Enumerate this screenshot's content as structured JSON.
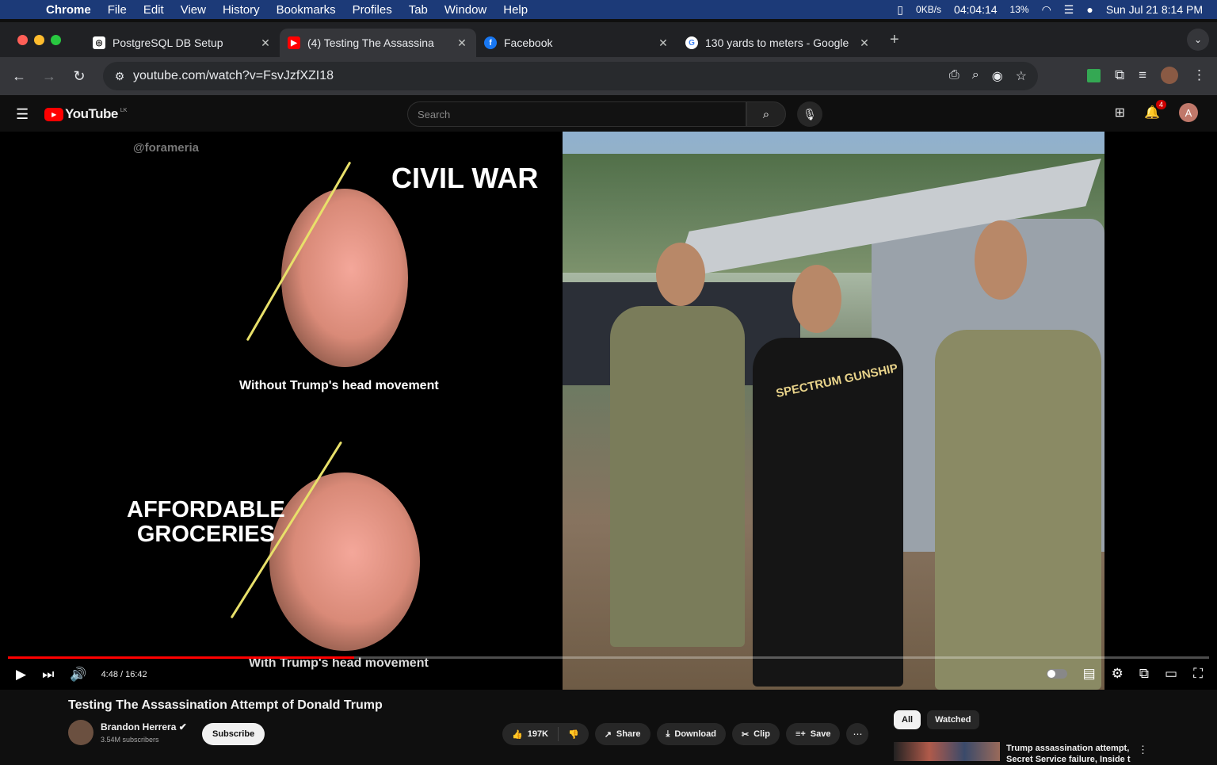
{
  "menubar": {
    "app": "Chrome",
    "items": [
      "File",
      "Edit",
      "View",
      "History",
      "Bookmarks",
      "Profiles",
      "Tab",
      "Window",
      "Help"
    ],
    "net": "0KB/s",
    "battery_time": "04:04:14",
    "battery_pct": "13%",
    "datetime": "Sun Jul 21  8:14 PM"
  },
  "tabs": [
    {
      "title": "PostgreSQL DB Setup",
      "icon": "openai-icon"
    },
    {
      "title": "(4) Testing The Assassina",
      "icon": "youtube-icon"
    },
    {
      "title": "Facebook",
      "icon": "facebook-icon"
    },
    {
      "title": "130 yards to meters - Google",
      "icon": "google-icon"
    }
  ],
  "address": {
    "url": "youtube.com/watch?v=FsvJzfXZI18"
  },
  "youtube": {
    "logo": "YouTube",
    "country": "LK",
    "search_placeholder": "Search",
    "notif_count": "4",
    "user_initial": "A"
  },
  "video": {
    "watermark": "@forameria",
    "civil_war": "CIVIL WAR",
    "caption_top": "Without Trump's head movement",
    "affordable_1": "AFFORDABLE",
    "affordable_2": "GROCERIES",
    "caption_bottom": "With Trump's head movement",
    "shirt_text": "SPECTRUM GUNSHIP",
    "time": "4:48 / 16:42",
    "progress": 0.288
  },
  "meta": {
    "title": "Testing The Assassination Attempt of Donald Trump",
    "channel": "Brandon Herrera",
    "subscribers": "3.54M subscribers",
    "subscribe_label": "Subscribe",
    "likes": "197K",
    "share_label": "Share",
    "download_label": "Download",
    "clip_label": "Clip",
    "save_label": "Save"
  },
  "sidebar": {
    "chips": [
      "All",
      "Watched"
    ],
    "rec_title": "Trump assassination attempt, Secret Service failure, Inside t"
  }
}
